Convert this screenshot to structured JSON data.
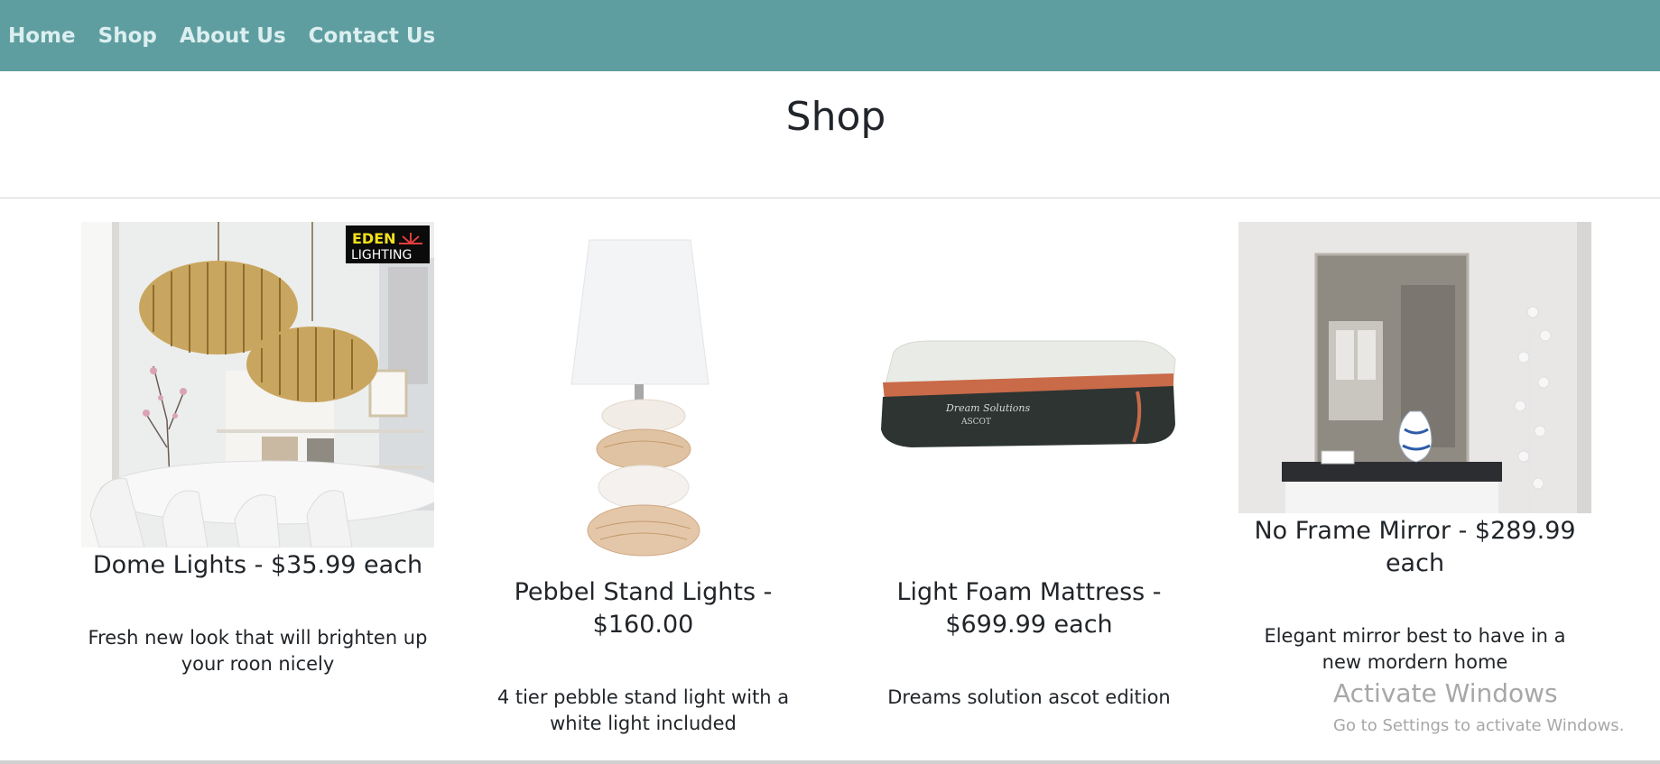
{
  "nav": {
    "items": [
      {
        "label": "Home"
      },
      {
        "label": "Shop"
      },
      {
        "label": "About Us"
      },
      {
        "label": "Contact Us"
      }
    ]
  },
  "page": {
    "title": "Shop"
  },
  "products": [
    {
      "name": "Dome Lights - $35.99 each",
      "description": "Fresh new look that will brighten up your roon nicely",
      "image_logo_text": [
        "EDEN",
        "LIGHTING"
      ]
    },
    {
      "name": "Pebbel Stand Lights - $160.00",
      "description": "4 tier pebble stand light with a white light included"
    },
    {
      "name": "Light Foam Mattress - $699.99 each",
      "description": "Dreams solution ascot edition",
      "image_label_text": [
        "Dream Solutions",
        "ASCOT"
      ]
    },
    {
      "name": "No Frame Mirror - $289.99 each",
      "description": "Elegant mirror best to have in a new mordern home"
    }
  ],
  "os_watermark": {
    "title": "Activate Windows",
    "subtitle": "Go to Settings to activate Windows."
  },
  "colors": {
    "navbar_bg": "#5f9ea0",
    "nav_text": "#dceff0",
    "text": "#212529"
  }
}
